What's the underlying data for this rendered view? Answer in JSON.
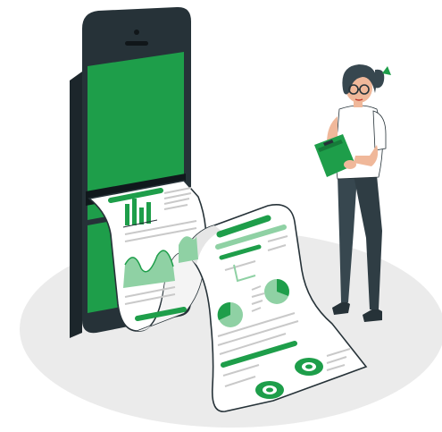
{
  "illustration": {
    "subject": "phone-printing-report",
    "colors": {
      "accent": "#1e9e4a",
      "accent_light": "#8fd1a4",
      "accent_pale": "#cfead8",
      "phone_body": "#263238",
      "floor": "#ebebeb",
      "paper": "#ffffff",
      "outline": "#263238",
      "skin": "#f0b89a",
      "hair": "#37474f",
      "pants": "#37474f",
      "shirt": "#ffffff"
    },
    "icons": [
      "phone-icon",
      "report-paper-icon",
      "bar-chart-icon",
      "area-chart-icon",
      "pie-chart-icon",
      "donut-chart-icon",
      "clipboard-icon",
      "person-icon"
    ]
  }
}
